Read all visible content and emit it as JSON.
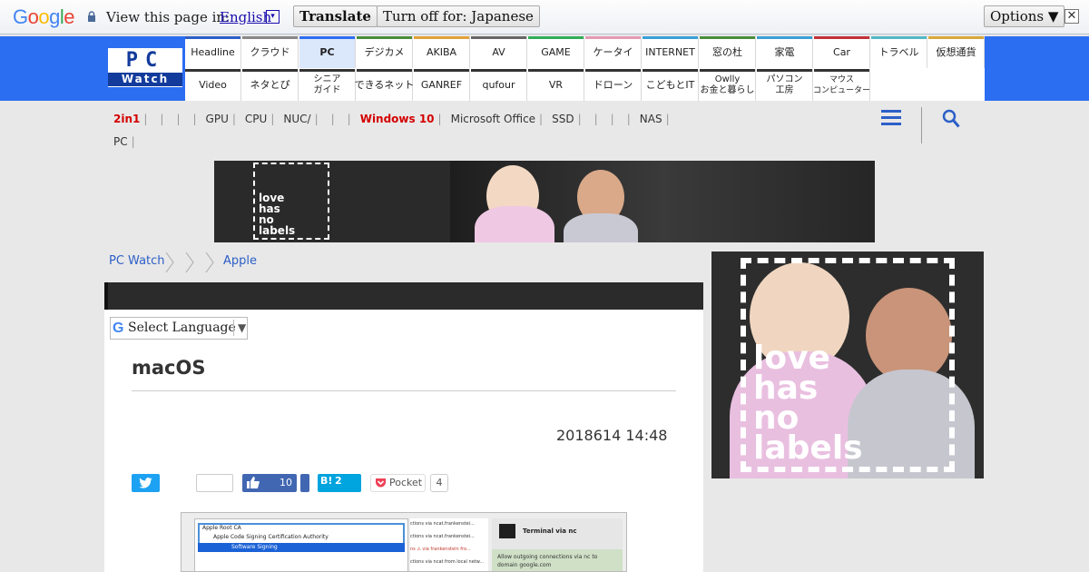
{
  "translate_bar": {
    "logo": [
      "G",
      "o",
      "o",
      "g",
      "l",
      "e"
    ],
    "logo_colors": [
      "#4285f4",
      "#ea4335",
      "#fbbc05",
      "#4285f4",
      "#34a853",
      "#ea4335"
    ],
    "prompt": "View this page in:",
    "language": "English",
    "language_arrow": "▾",
    "translate_button": "Translate",
    "turn_off_button": "Turn off for: Japanese",
    "options_button": "Options ▼",
    "close": "✕"
  },
  "site": {
    "logo_pc": "PC",
    "logo_watch": "Watch",
    "nav_top": [
      {
        "label": "Headline",
        "color": "#2c5fc7"
      },
      {
        "label": "クラウド",
        "color": "#888888"
      },
      {
        "label": "PC",
        "color": "#2c6ef2"
      },
      {
        "label": "デジカメ",
        "color": "#4a8d3a"
      },
      {
        "label": "AKIBA",
        "color": "#e2a13a"
      },
      {
        "label": "AV",
        "color": "#666666"
      },
      {
        "label": "GAME",
        "color": "#2fae58"
      },
      {
        "label": "ケータイ",
        "color": "#e59ab4"
      },
      {
        "label": "INTERNET",
        "color": "#3aa0d8"
      },
      {
        "label": "窓の杜",
        "color": "#4a8d3a"
      },
      {
        "label": "家電",
        "color": "#3a9fd6"
      },
      {
        "label": "Car",
        "color": "#c2303a"
      },
      {
        "label": "トラベル",
        "color": "#52b7c7"
      },
      {
        "label": "仮想通貨",
        "color": "#d8a83a"
      }
    ],
    "nav_bottom": [
      "Video",
      "ネタとぴ",
      "シニア\nガイド",
      "できるネット",
      "GANREF",
      "qufour",
      "VR",
      "ドローン",
      "こどもとIT",
      "Owlly\nお金と暮らし",
      "パソコン\n工房",
      "マウス\nコンピューター"
    ],
    "nav_bottom_color": "#333333"
  },
  "tags": {
    "row1": [
      "2in1",
      "",
      "",
      "",
      "GPU",
      "CPU",
      "NUC/",
      "",
      "",
      "Windows 10",
      "Microsoft Office",
      "SSD",
      "",
      "",
      "",
      "NAS"
    ],
    "row2": [
      "PC"
    ]
  },
  "banner": {
    "lhnl": "love\nhas\nno\nlabels"
  },
  "breadcrumb": [
    "PC Watch",
    "Apple"
  ],
  "article": {
    "select_language": "Select Language",
    "select_language_g": "G",
    "select_language_arrow": "▼",
    "title": "macOS",
    "date": "2018614 14:48",
    "facebook_count": "10",
    "hatena_label": "B!",
    "hatena_count": "2",
    "pocket_label": "Pocket",
    "pocket_count": "4"
  },
  "screenshot_thumb": {
    "tree": [
      "Apple Root CA",
      "Apple Code Signing Certification Authority",
      "Software Signing"
    ],
    "middle": [
      "ctions via ncat.frankenstei...",
      "ctions via ncat.frankenstei...",
      "ns ⚠ via frankenstein fro...",
      "ctions via ncat from local netw..."
    ],
    "terminal_title": "Terminal via nc",
    "allow_text": "Allow outgoing connections via nc to domain google.com"
  },
  "side_ad": {
    "lhnl": "love\nhas\nno\nlabels"
  }
}
